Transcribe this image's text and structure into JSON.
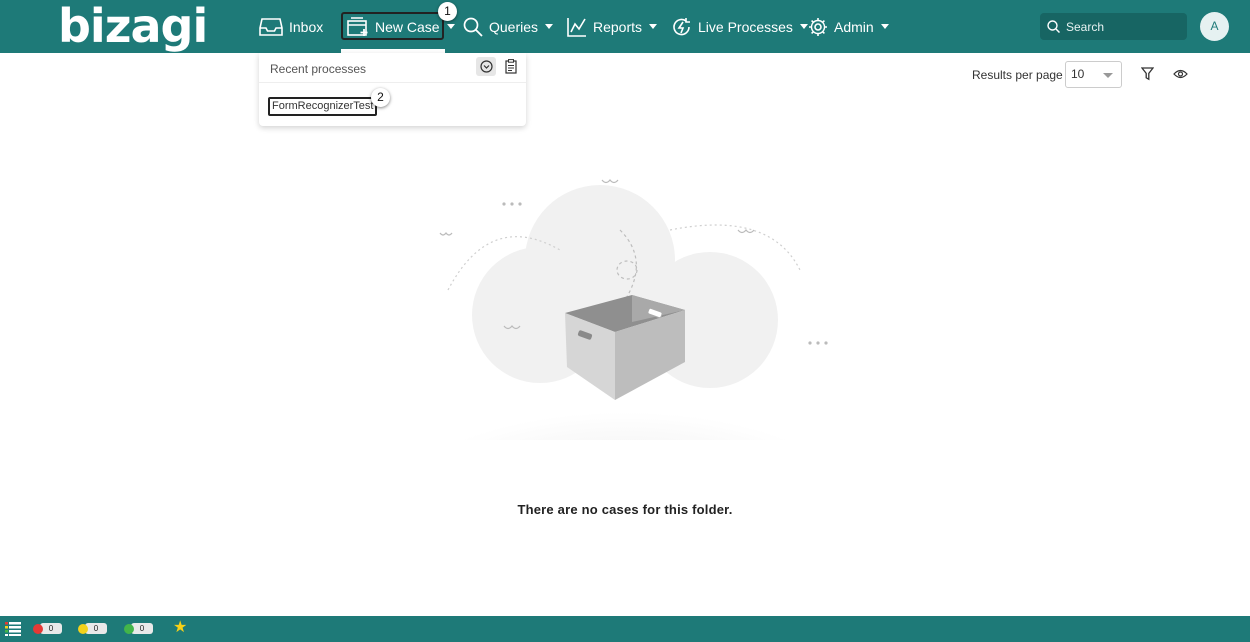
{
  "nav": {
    "logo": "bizagi",
    "items": [
      {
        "label": "Inbox"
      },
      {
        "label": "New Case"
      },
      {
        "label": "Queries"
      },
      {
        "label": "Reports"
      },
      {
        "label": "Live Processes"
      },
      {
        "label": "Admin"
      }
    ],
    "search_placeholder": "Search",
    "avatar_initial": "A"
  },
  "annotations": {
    "badge1": "1",
    "badge2": "2"
  },
  "dropdown": {
    "title": "Recent processes",
    "processes": [
      "FormRecognizerTest"
    ]
  },
  "results": {
    "label": "Results per page",
    "value": "10"
  },
  "empty_message": "There are no cases for this folder.",
  "status_bar": {
    "red_count": "0",
    "yellow_count": "0",
    "green_count": "0"
  },
  "colors": {
    "brand": "#1e7a78",
    "red": "#e53935",
    "yellow": "#f4d21c",
    "green": "#43b549",
    "star": "#f7d117"
  }
}
